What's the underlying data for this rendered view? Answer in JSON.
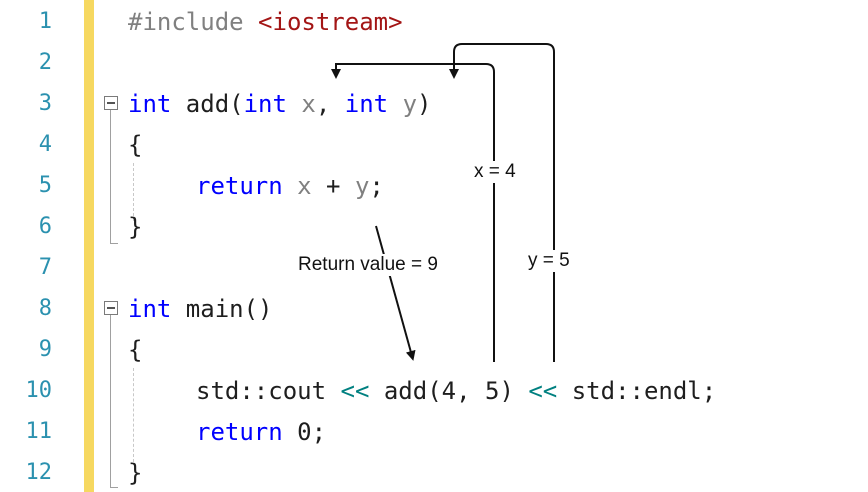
{
  "editor": {
    "line_numbers": [
      "1",
      "2",
      "3",
      "4",
      "5",
      "6",
      "7",
      "8",
      "9",
      "10",
      "11",
      "12"
    ],
    "code": {
      "l1": {
        "directive": "#include",
        "header": "<iostream>"
      },
      "l3": {
        "kw1": "int",
        "fn": " add(",
        "kw2": "int",
        "p1": " x",
        "comma": ", ",
        "kw3": "int",
        "p2": " y",
        "close": ")"
      },
      "l4": {
        "text": "{"
      },
      "l5": {
        "kw": "return",
        "p1": " x",
        "plus": " + ",
        "p2": "y",
        "end": ";"
      },
      "l6": {
        "text": "}"
      },
      "l8": {
        "kw": "int",
        "rest": " main()"
      },
      "l9": {
        "text": "{"
      },
      "l10": {
        "a": "std::cout ",
        "op1": "<<",
        "b": " add(4, 5) ",
        "op2": "<<",
        "c": " std::endl;"
      },
      "l11": {
        "kw": "return",
        "rest": " 0;"
      },
      "l12": {
        "text": "}"
      }
    }
  },
  "annotations": {
    "x_label": "x = 4",
    "y_label": "y = 5",
    "return_label": "Return value = 9"
  },
  "colors": {
    "line_number": "#2b91af",
    "keyword": "#0000ff",
    "parameter": "#808080",
    "string": "#a31515",
    "operator": "#008080",
    "change_bar": "#f6d860"
  }
}
